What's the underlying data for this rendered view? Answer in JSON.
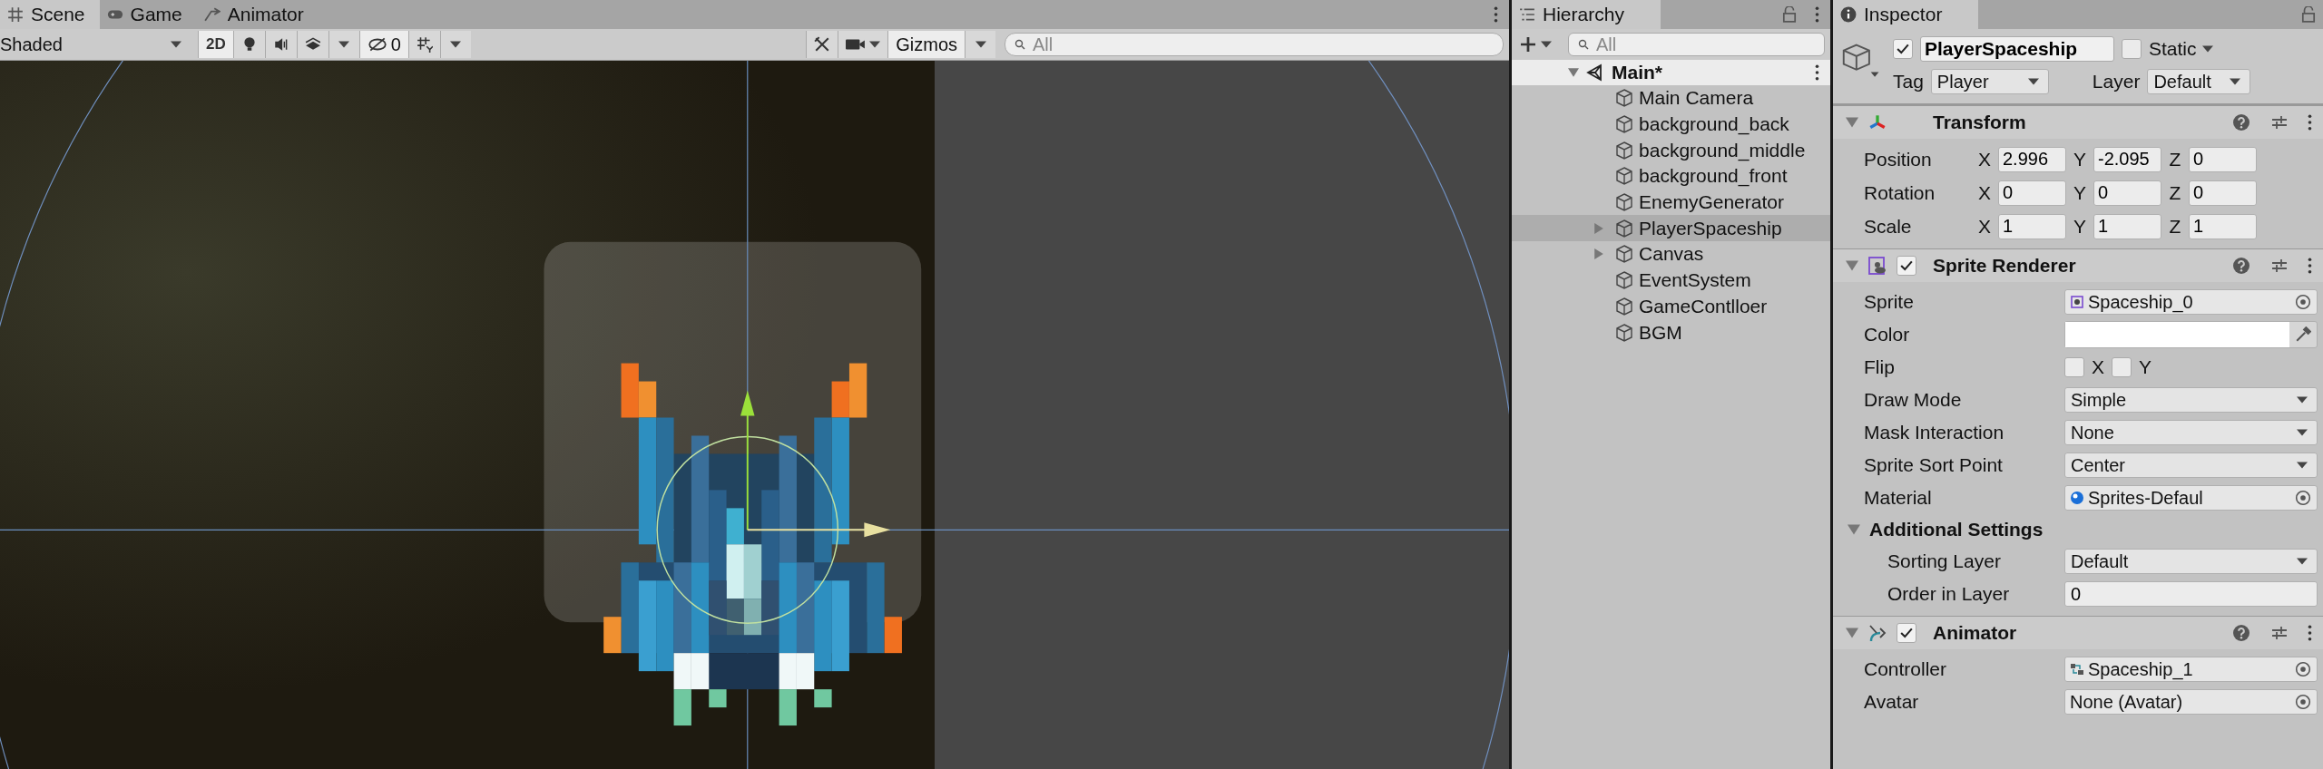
{
  "scene_view": {
    "tabs": [
      {
        "kind": "scene",
        "label": "Scene",
        "selected": true
      },
      {
        "kind": "game",
        "label": "Game",
        "selected": false
      },
      {
        "kind": "animator",
        "label": "Animator",
        "selected": false
      }
    ],
    "toolbar": {
      "draw_mode": "Shaded",
      "mode_2d": {
        "label": "2D",
        "on": true
      },
      "hidden_count": "0",
      "gizmos": "Gizmos",
      "search_placeholder": "All"
    }
  },
  "hierarchy": {
    "title": "Hierarchy",
    "search_placeholder": "All",
    "scene": {
      "name": "Main*",
      "expanded": true,
      "children": [
        {
          "name": "Main Camera",
          "selected": false
        },
        {
          "name": "background_back",
          "selected": false
        },
        {
          "name": "background_middle",
          "selected": false
        },
        {
          "name": "background_front",
          "selected": false
        },
        {
          "name": "EnemyGenerator",
          "selected": false
        },
        {
          "name": "PlayerSpaceship",
          "selected": true,
          "expanded": false
        },
        {
          "name": "Canvas",
          "selected": false,
          "expanded": false
        },
        {
          "name": "EventSystem",
          "selected": false
        },
        {
          "name": "GameContlloer",
          "selected": false
        },
        {
          "name": "BGM",
          "selected": false
        }
      ]
    }
  },
  "inspector": {
    "title": "Inspector",
    "object": {
      "active": true,
      "name": "PlayerSpaceship",
      "static": false,
      "static_label": "Static",
      "tag_label": "Tag",
      "tag": "Player",
      "layer_label": "Layer",
      "layer": "Default"
    },
    "components": [
      {
        "kind": "transform",
        "title": "Transform",
        "expanded": true,
        "rows": [
          {
            "label": "Position",
            "values": [
              {
                "axis": "X",
                "value": "2.996"
              },
              {
                "axis": "Y",
                "value": "-2.095"
              },
              {
                "axis": "Z",
                "value": "0"
              }
            ]
          },
          {
            "label": "Rotation",
            "values": [
              {
                "axis": "X",
                "value": "0"
              },
              {
                "axis": "Y",
                "value": "0"
              },
              {
                "axis": "Z",
                "value": "0"
              }
            ]
          },
          {
            "label": "Scale",
            "values": [
              {
                "axis": "X",
                "value": "1"
              },
              {
                "axis": "Y",
                "value": "1"
              },
              {
                "axis": "Z",
                "value": "1"
              }
            ]
          }
        ]
      },
      {
        "kind": "sprite_renderer",
        "title": "Sprite Renderer",
        "enabled": true,
        "expanded": true,
        "fields": [
          {
            "kind": "sprite_ref",
            "label": "Sprite",
            "value": "Spaceship_0"
          },
          {
            "kind": "color",
            "label": "Color",
            "color": "#ffffff"
          },
          {
            "kind": "flip",
            "label": "Flip",
            "x_label": "X",
            "x": false,
            "y_label": "Y",
            "y": false
          },
          {
            "kind": "dropdown",
            "label": "Draw Mode",
            "value": "Simple"
          },
          {
            "kind": "dropdown",
            "label": "Mask Interaction",
            "value": "None"
          },
          {
            "kind": "dropdown",
            "label": "Sprite Sort Point",
            "value": "Center"
          },
          {
            "kind": "material_ref",
            "label": "Material",
            "value": "Sprites-Defaul"
          }
        ],
        "subsection": {
          "title": "Additional Settings",
          "expanded": true,
          "fields": [
            {
              "kind": "dropdown",
              "label": "Sorting Layer",
              "value": "Default"
            },
            {
              "kind": "number",
              "label": "Order in Layer",
              "value": "0"
            }
          ]
        }
      },
      {
        "kind": "animator",
        "title": "Animator",
        "enabled": true,
        "expanded": true,
        "fields": [
          {
            "kind": "controller_ref",
            "label": "Controller",
            "value": "Spaceship_1"
          },
          {
            "kind": "object_ref",
            "label": "Avatar",
            "value": "None (Avatar)"
          }
        ]
      }
    ]
  }
}
